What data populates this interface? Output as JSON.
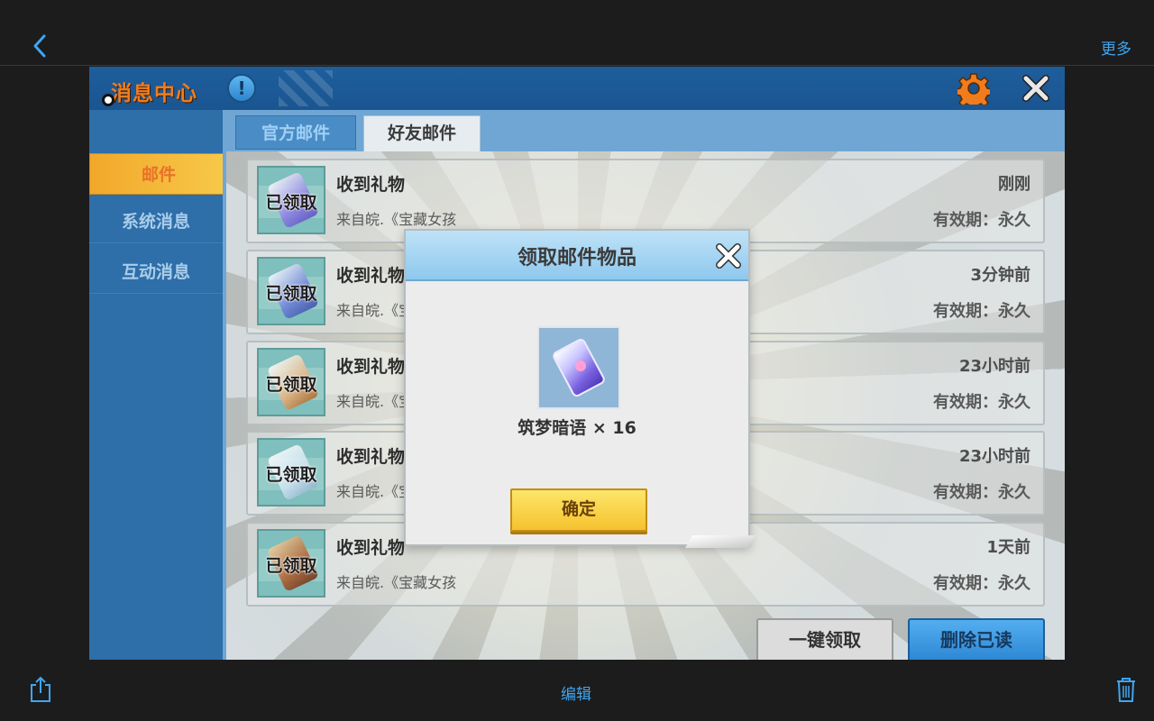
{
  "nav": {
    "back_icon": "chevron-left-icon",
    "more_label": "更多"
  },
  "bottom": {
    "share_icon": "share-icon",
    "edit_label": "编辑",
    "trash_icon": "trash-icon"
  },
  "game": {
    "title": "消息中心",
    "info_icon_text": "!",
    "settings_icon": "gear-icon",
    "close_icon": "close-icon",
    "sidebar": {
      "items": [
        {
          "label": "邮件",
          "active": true
        },
        {
          "label": "系统消息",
          "active": false
        },
        {
          "label": "互动消息",
          "active": false
        }
      ]
    },
    "tabs": [
      {
        "label": "官方邮件",
        "active": false
      },
      {
        "label": "好友邮件",
        "active": true
      }
    ],
    "mails": [
      {
        "title": "收到礼物",
        "from": "来自皖.《宝藏女孩",
        "time": "刚刚",
        "expire": "有效期：永久",
        "status": "已领取"
      },
      {
        "title": "收到礼物",
        "from": "来自皖.《宝",
        "time": "3分钟前",
        "expire": "有效期：永久",
        "status": "已领取"
      },
      {
        "title": "收到礼物",
        "from": "来自皖.《宝",
        "time": "23小时前",
        "expire": "有效期：永久",
        "status": "已领取"
      },
      {
        "title": "收到礼物",
        "from": "来自皖.《宝",
        "time": "23小时前",
        "expire": "有效期：永久",
        "status": "已领取"
      },
      {
        "title": "收到礼物",
        "from": "来自皖.《宝藏女孩",
        "time": "1天前",
        "expire": "有效期：永久",
        "status": "已领取"
      }
    ],
    "buttons": {
      "claim_all": "一键领取",
      "delete_read": "删除已读"
    },
    "dialog": {
      "title": "领取邮件物品",
      "item_label": "筑梦暗语 × 16",
      "confirm": "确定"
    }
  },
  "colors": {
    "accent": "#3ea6f2",
    "title_orange": "#f07c1e",
    "confirm_yellow": "#f5c22e"
  }
}
